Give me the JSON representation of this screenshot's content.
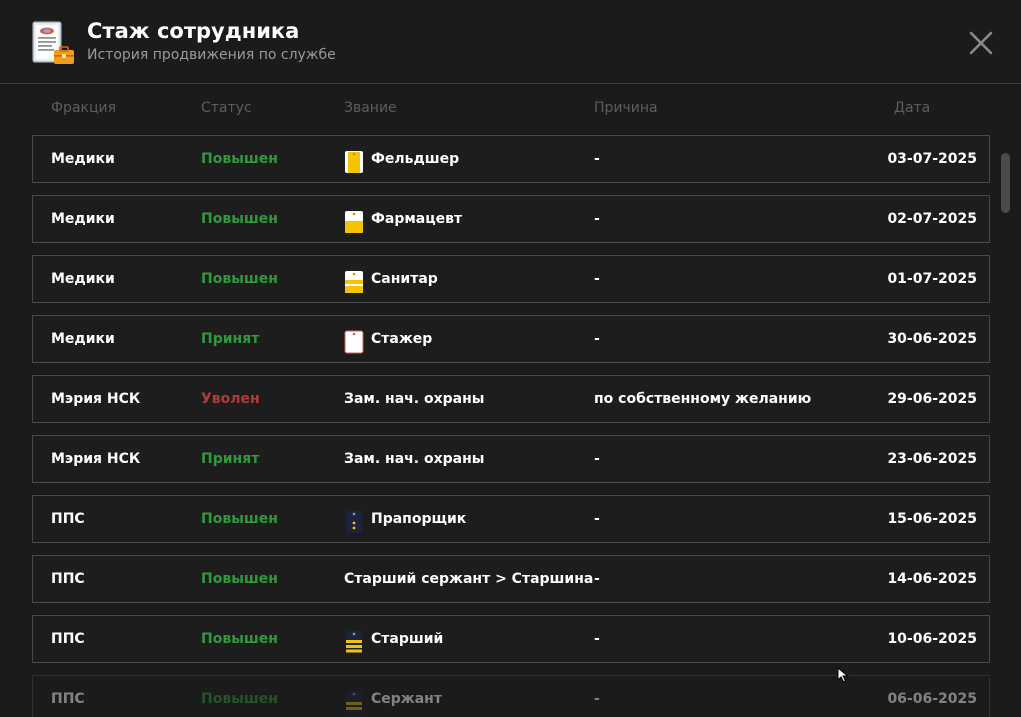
{
  "header": {
    "title": "Стаж сотрудника",
    "subtitle": "История продвижения по службе",
    "icon": "document-briefcase-icon",
    "close_icon": "close-icon"
  },
  "columns": {
    "faction": "Фракция",
    "status": "Статус",
    "rank": "Звание",
    "reason": "Причина",
    "date": "Дата"
  },
  "colors": {
    "promoted": "#2f9a3c",
    "hired": "#2f9a3c",
    "fired": "#b23a3a",
    "epaulette_yellow": "#f5c400",
    "epaulette_navy": "#1c2340"
  },
  "rows": [
    {
      "faction": "Медики",
      "status": "Повышен",
      "status_type": "promoted",
      "rank": "Фельдшер",
      "rank_icon": "yellow-epaulette-stripe-icon",
      "reason": "-",
      "date": "03-07-2025"
    },
    {
      "faction": "Медики",
      "status": "Повышен",
      "status_type": "promoted",
      "rank": "Фармацевт",
      "rank_icon": "yellow-epaulette-half-icon",
      "reason": "-",
      "date": "02-07-2025"
    },
    {
      "faction": "Медики",
      "status": "Повышен",
      "status_type": "promoted",
      "rank": "Санитар",
      "rank_icon": "yellow-epaulette-bars-icon",
      "reason": "-",
      "date": "01-07-2025"
    },
    {
      "faction": "Медики",
      "status": "Принят",
      "status_type": "hired",
      "rank": "Стажер",
      "rank_icon": "white-epaulette-icon",
      "reason": "-",
      "date": "30-06-2025"
    },
    {
      "faction": "Мэрия НСК",
      "status": "Уволен",
      "status_type": "fired",
      "rank": "Зам. нач. охраны",
      "rank_icon": "",
      "reason": "по собственному желанию",
      "date": "29-06-2025"
    },
    {
      "faction": "Мэрия НСК",
      "status": "Принят",
      "status_type": "hired",
      "rank": "Зам. нач. охраны",
      "rank_icon": "",
      "reason": "-",
      "date": "23-06-2025"
    },
    {
      "faction": "ППС",
      "status": "Повышен",
      "status_type": "promoted",
      "rank": "Прапорщик",
      "rank_icon": "navy-epaulette-stars-icon",
      "reason": "-",
      "date": "15-06-2025"
    },
    {
      "faction": "ППС",
      "status": "Повышен",
      "status_type": "promoted",
      "rank": "Старший сержант > Старшина",
      "rank_icon": "",
      "reason": "-",
      "date": "14-06-2025"
    },
    {
      "faction": "ППС",
      "status": "Повышен",
      "status_type": "promoted",
      "rank": "Старший",
      "rank_icon": "navy-epaulette-yellow-bars-icon",
      "reason": "-",
      "date": "10-06-2025"
    },
    {
      "faction": "ППС",
      "status": "Повышен",
      "status_type": "promoted",
      "rank": "Сержант",
      "rank_icon": "navy-epaulette-gold-bars-icon",
      "reason": "-",
      "date": "06-06-2025"
    }
  ]
}
